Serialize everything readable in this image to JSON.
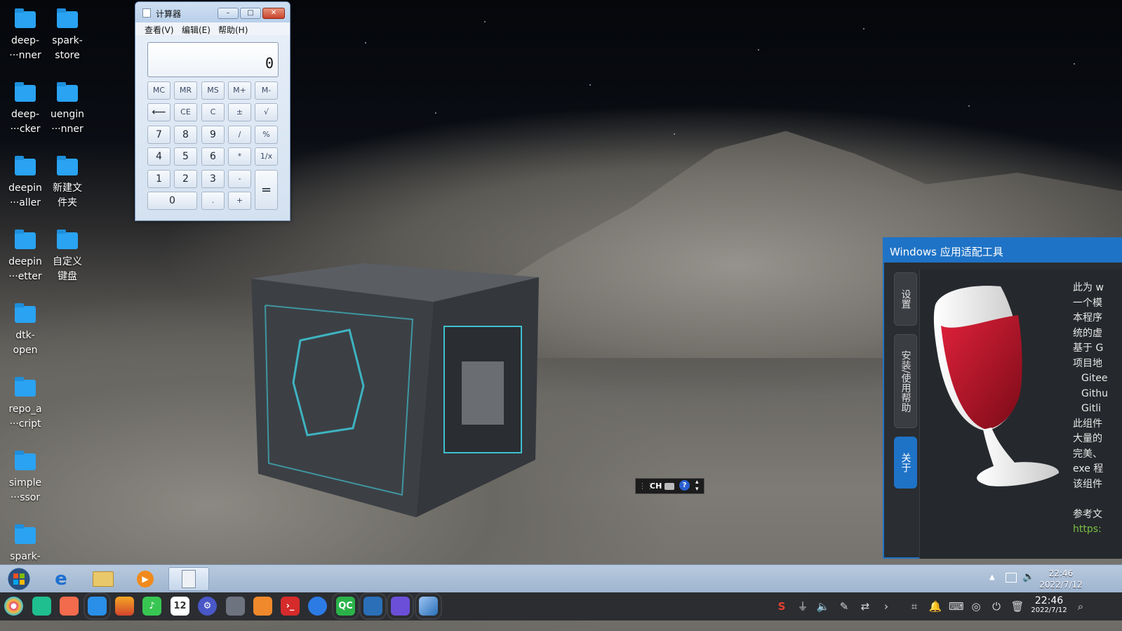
{
  "desktop": {
    "icons": [
      {
        "label_line1": "deep-",
        "label_line2": "···nner"
      },
      {
        "label_line1": "spark-",
        "label_line2": "store"
      },
      {
        "label_line1": "deep-",
        "label_line2": "···cker"
      },
      {
        "label_line1": "uengin",
        "label_line2": "···nner"
      },
      {
        "label_line1": "deepin",
        "label_line2": "···aller"
      },
      {
        "label_line1": "新建文",
        "label_line2": "件夹"
      },
      {
        "label_line1": "deepin",
        "label_line2": "···etter"
      },
      {
        "label_line1": "自定义",
        "label_line2": "键盘"
      },
      {
        "label_line1": "dtk-",
        "label_line2": "open"
      },
      {
        "label_line1": "repo_a",
        "label_line2": "···cript"
      },
      {
        "label_line1": "simple",
        "label_line2": "···ssor"
      },
      {
        "label_line1": "spark-",
        "label_line2": ""
      }
    ]
  },
  "calculator": {
    "title": "计算器",
    "window_buttons": {
      "minimize": "–",
      "maximize": "□",
      "close": "✕"
    },
    "menu": [
      "查看(V)",
      "编辑(E)",
      "帮助(H)"
    ],
    "display": "0",
    "buttons": {
      "mc": "MC",
      "mr": "MR",
      "ms": "MS",
      "mplus": "M+",
      "mminus": "M-",
      "back": "⟵",
      "ce": "CE",
      "c": "C",
      "plusminus": "±",
      "sqrt": "√",
      "n7": "7",
      "n8": "8",
      "n9": "9",
      "div": "/",
      "pct": "%",
      "n4": "4",
      "n5": "5",
      "n6": "6",
      "mul": "*",
      "recip": "1/x",
      "n1": "1",
      "n2": "2",
      "n3": "3",
      "minus": "-",
      "equals": "=",
      "n0": "0",
      "dot": ".",
      "plus": "+"
    }
  },
  "ime": {
    "mode": "CH"
  },
  "wine": {
    "title": "Windows 应用适配工具",
    "tabs": [
      "设置",
      "安装/使用帮助",
      "关于"
    ],
    "active_tab": "关于",
    "text_lines": [
      "此为 w",
      "一个模",
      "本程序",
      "统的虚",
      "基于 G",
      "项目地",
      "Gitee",
      "Githu",
      "Gitli",
      "此组件",
      "大量的",
      "完美、",
      "exe 程",
      "该组件",
      "",
      "参考文",
      "https:"
    ]
  },
  "taskbar_top": {
    "clock_time": "22:46",
    "clock_date": "2022/7/12"
  },
  "taskbar_bottom": {
    "calendar_day": "12",
    "qc_label": "QC",
    "clock_time": "22:46",
    "clock_date": "2022/7/12"
  },
  "colors": {
    "accent": "#1f73c6",
    "link": "#7bc043",
    "folder": "#29a3f2"
  }
}
